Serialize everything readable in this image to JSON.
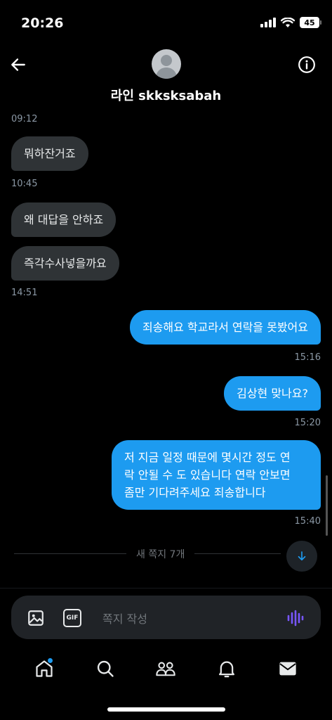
{
  "status": {
    "time": "20:26",
    "battery": "45"
  },
  "header": {
    "name": "라인 skksksabah"
  },
  "messages": [
    {
      "time": "09:12"
    },
    {
      "text": "뭐하잔거죠",
      "time": "10:45"
    },
    {
      "text": "왜 대답을 안하죠"
    },
    {
      "text": "즉각수사넣을까요",
      "time": "14:51"
    },
    {
      "text": "죄송해요 학교라서 연락을 못봤어요",
      "time": "15:16"
    },
    {
      "text": "김상현 맞나요?",
      "time": "15:20"
    },
    {
      "line1": "저 지금 일정 때문에 몇시간 정도 연",
      "line2": "락 안될 수 도 있습니다 연락 안보면",
      "line3": "좀만 기다려주세요 죄송합니다",
      "time": "15:40"
    }
  ],
  "new_messages_label": "새 쪽지 7개",
  "composer": {
    "gif_label": "GIF",
    "placeholder": "쪽지 작성"
  },
  "colors": {
    "accent": "#1d9bf0",
    "incoming_bubble": "#2f3336",
    "background": "#000000"
  },
  "icons": {
    "back": "arrow-left-icon",
    "info": "info-icon",
    "image": "image-icon",
    "gif": "gif-icon",
    "voice": "voice-wave-icon",
    "scroll": "arrow-down-icon",
    "nav": [
      "home-icon",
      "search-icon",
      "communities-icon",
      "notifications-icon",
      "messages-icon"
    ]
  }
}
